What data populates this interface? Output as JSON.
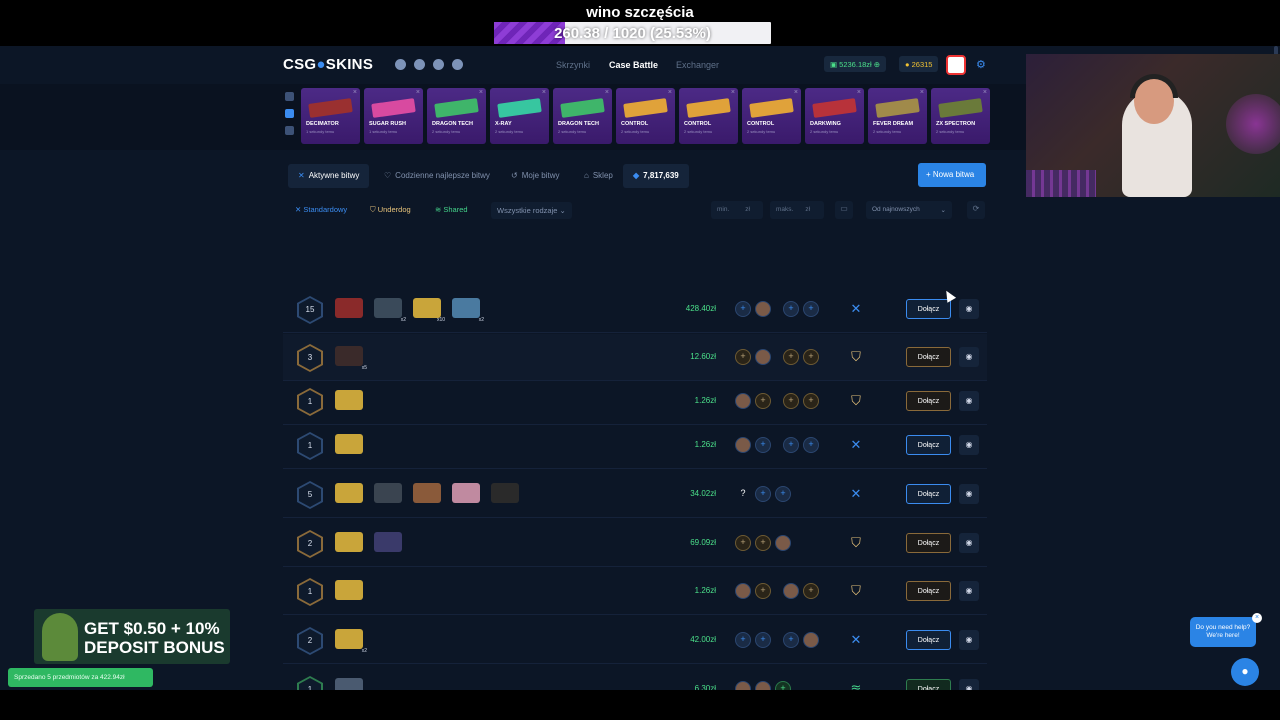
{
  "stream": {
    "title": "wino szczęścia",
    "progress_text": "260.38 / 1020 (25.53%)",
    "progress_fraction": 0.2553
  },
  "header": {
    "logo_left": "CSG",
    "logo_right": "SKINS",
    "nav": [
      "Skrzynki",
      "Case Battle",
      "Exchanger"
    ],
    "active_nav": "Case Battle",
    "balance": "5236.18zł",
    "coins": "26315"
  },
  "drops": [
    {
      "name": "DECIMATOR",
      "sub": "1 sekundy temu",
      "color": "#9a3030"
    },
    {
      "name": "SUGAR RUSH",
      "sub": "1 sekundy temu",
      "color": "#d84aa0"
    },
    {
      "name": "DRAGON TECH",
      "sub": "2 sekundy temu",
      "color": "#3fb56a"
    },
    {
      "name": "X-RAY",
      "sub": "2 sekundy temu",
      "color": "#37c6a0"
    },
    {
      "name": "DRAGON TECH",
      "sub": "2 sekundy temu",
      "color": "#3fb56a"
    },
    {
      "name": "CONTROL",
      "sub": "2 sekundy temu",
      "color": "#e0a23a"
    },
    {
      "name": "CONTROL",
      "sub": "2 sekundy temu",
      "color": "#e0a23a"
    },
    {
      "name": "CONTROL",
      "sub": "2 sekundy temu",
      "color": "#e0a23a"
    },
    {
      "name": "DARKWING",
      "sub": "2 sekundy temu",
      "color": "#b8323a"
    },
    {
      "name": "FEVER DREAM",
      "sub": "2 sekundy temu",
      "color": "#a08a4a"
    },
    {
      "name": "ZX SPECTRON",
      "sub": "2 sekundy temu",
      "color": "#6a7a3a"
    }
  ],
  "tabs": {
    "active": "Aktywne bitwy",
    "daily": "Codzienne najlepsze bitwy",
    "mine": "Moje bitwy",
    "shop": "Sklep",
    "coins": "7,817,639",
    "new_battle": "+ Nowa bitwa"
  },
  "filters": {
    "standard": "Standardowy",
    "underdog": "Underdog",
    "shared": "Shared",
    "kinds": "Wszystkie rodzaje",
    "min": "min.",
    "max": "maks.",
    "currency": "zł",
    "sort": "Od najnowszych"
  },
  "join_label": "Dołącz",
  "rows": [
    {
      "rounds": "15",
      "price": "428.40zł",
      "mode": "standard"
    },
    {
      "rounds": "3",
      "price": "12.60zł",
      "mode": "underdog"
    },
    {
      "rounds": "1",
      "price": "1.26zł",
      "mode": "underdog"
    },
    {
      "rounds": "1",
      "price": "1.26zł",
      "mode": "standard"
    },
    {
      "rounds": "5",
      "price": "34.02zł",
      "mode": "standard"
    },
    {
      "rounds": "2",
      "price": "69.09zł",
      "mode": "underdog"
    },
    {
      "rounds": "1",
      "price": "1.26zł",
      "mode": "underdog"
    },
    {
      "rounds": "2",
      "price": "42.00zł",
      "mode": "standard"
    },
    {
      "rounds": "1",
      "price": "6.30zł",
      "mode": "shared"
    }
  ],
  "promo": {
    "line1": "GET $0.50 + 10%",
    "line2": "DEPOSIT BONUS"
  },
  "toast": "Sprzedano 5 przedmiotów za 422.94zł",
  "help": {
    "line1": "Do you need help?",
    "line2": "We're here!"
  },
  "colors": {
    "accent": "#2b84e5",
    "price_green": "#4be08a",
    "underdog_gold": "#e6c27a",
    "shared_green": "#44d38a"
  }
}
